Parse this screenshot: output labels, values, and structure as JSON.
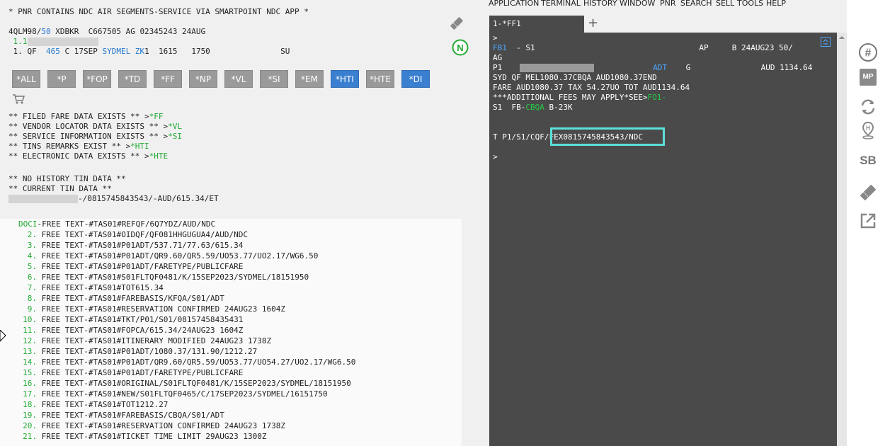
{
  "left": {
    "header_lines": [
      "* PNR CONTAINS NDC AIR SEGMENTS-SERVICE VIA SMARTPOINT NDC APP *"
    ],
    "record_line_a": "4QLM98/",
    "record_line_b": "50",
    "record_line_c": " XDBKR  C667505 AG 02345243 24AUG",
    "pax_line": " 1.1",
    "seg_prefix": " 1. QF  ",
    "seg_flight": "465",
    "seg_class": " C 17SEP ",
    "seg_citypair": "SYDMEL",
    "seg_status": " ZK",
    "seg_rest": "1  1615   1750               SU",
    "buttons": [
      "*ALL",
      "*P",
      "*FOP",
      "*TD",
      "*FF",
      "*NP",
      "*VL",
      "*SI",
      "*EM",
      "*HTI",
      "*HTE",
      "*DI"
    ],
    "info_lines": [
      {
        "text": "** FILED FARE DATA EXISTS ** >",
        "link": "*FF"
      },
      {
        "text": "** VENDOR LOCATOR DATA EXISTS ** >",
        "link": "*VL"
      },
      {
        "text": "** SERVICE INFORMATION EXISTS ** >",
        "link": "*SI"
      },
      {
        "text": "** TINS REMARKS EXIST ** >",
        "link": "*HTI"
      },
      {
        "text": "** ELECTRONIC DATA EXISTS ** >",
        "link": "*HTE"
      }
    ],
    "tin_lines": [
      "** NO HISTORY TIN DATA **",
      "** CURRENT TIN DATA **"
    ],
    "tin_value": "-/0815745843543/-AUD/615.34/ET",
    "doci_label": "DOCI",
    "doci_text": "-FREE TEXT-#TAS01#REFQF/6Q7YDZ/AUD/NDC",
    "free_text": [
      {
        "n": "2.",
        "t": "FREE TEXT-#TAS01#OIDQF/QF081HHGUGUA4/AUD/NDC"
      },
      {
        "n": "3.",
        "t": "FREE TEXT-#TAS01#P01ADT/537.71/77.63/615.34"
      },
      {
        "n": "4.",
        "t": "FREE TEXT-#TAS01#P01ADT/QR9.60/QR5.59/UO53.77/UO2.17/WG6.50"
      },
      {
        "n": "5.",
        "t": "FREE TEXT-#TAS01#P01ADT/FARETYPE/PUBLICFARE"
      },
      {
        "n": "6.",
        "t": "FREE TEXT-#TAS01#S01FLTQF0481/K/15SEP2023/SYDMEL/18151950"
      },
      {
        "n": "7.",
        "t": "FREE TEXT-#TAS01#TOT615.34"
      },
      {
        "n": "8.",
        "t": "FREE TEXT-#TAS01#FAREBASIS/KFQA/S01/ADT"
      },
      {
        "n": "9.",
        "t": "FREE TEXT-#TAS01#RESERVATION CONFIRMED 24AUG23 1604Z"
      },
      {
        "n": "10.",
        "t": "FREE TEXT-#TAS01#TKT/P01/S01/08157458435431"
      },
      {
        "n": "11.",
        "t": "FREE TEXT-#TAS01#FOPCA/615.34/24AUG23 1604Z"
      },
      {
        "n": "12.",
        "t": "FREE TEXT-#TAS01#ITINERARY MODIFIED 24AUG23 1738Z"
      },
      {
        "n": "13.",
        "t": "FREE TEXT-#TAS01#P01ADT/1080.37/131.90/1212.27"
      },
      {
        "n": "14.",
        "t": "FREE TEXT-#TAS01#P01ADT/QR9.60/QR5.59/UO53.77/UO54.27/UO2.17/WG6.50"
      },
      {
        "n": "15.",
        "t": "FREE TEXT-#TAS01#P01ADT/FARETYPE/PUBLICFARE"
      },
      {
        "n": "16.",
        "t": "FREE TEXT-#TAS01#ORIGINAL/S01FLTQF0481/K/15SEP2023/SYDMEL/18151950"
      },
      {
        "n": "17.",
        "t": "FREE TEXT-#TAS01#NEW/S01FLTQF0465/C/17SEP2023/SYDMEL/16151750"
      },
      {
        "n": "18.",
        "t": "FREE TEXT-#TAS01#TOT1212.27"
      },
      {
        "n": "19.",
        "t": "FREE TEXT-#TAS01#FAREBASIS/CBQA/S01/ADT"
      },
      {
        "n": "20.",
        "t": "FREE TEXT-#TAS01#RESERVATION CONFIRMED 24AUG23 1738Z"
      },
      {
        "n": "21.",
        "t": "FREE TEXT-#TAS01#TICKET TIME LIMIT 29AUG23 1300Z"
      }
    ]
  },
  "menu": [
    "APPLICATION",
    "TERMINAL",
    "HISTORY",
    "WINDOW",
    "PNR",
    "SEARCH",
    "SELL",
    "TOOLS",
    "HELP"
  ],
  "terminal": {
    "tab_label": "1-*FF1",
    "add_tab": "+",
    "prompt1": ">",
    "fb1_label": "FB1",
    "fb1_rest": "  - S1                                   AP     B 24AUG23 50/",
    "ag_line": "AG",
    "p1_label": "P1",
    "p1_adt": "ADT",
    "p1_rest": "    G               AUD 1134.64",
    "line_fare1": "SYD QF MEL1080.37CBQA AUD1080.37END",
    "line_fare2": "FARE AUD1080.37 TAX 54.27UO TOT AUD1134.64",
    "line_fees": "***ADDITIONAL FEES MAY APPLY*SEE>",
    "fees_link": "FO1-",
    "s1_pre": "S1  FB-",
    "s1_cbqa": "CBQA",
    "s1_post": " B-23K",
    "t_line_pre": "T P1/S1/CQF/",
    "t_line_hl": "FEX0815745843543/NDC",
    "prompt2": ">"
  },
  "sidebar": {
    "hash_icon": "#",
    "mp_label": "MP",
    "sb_label": "SB"
  }
}
